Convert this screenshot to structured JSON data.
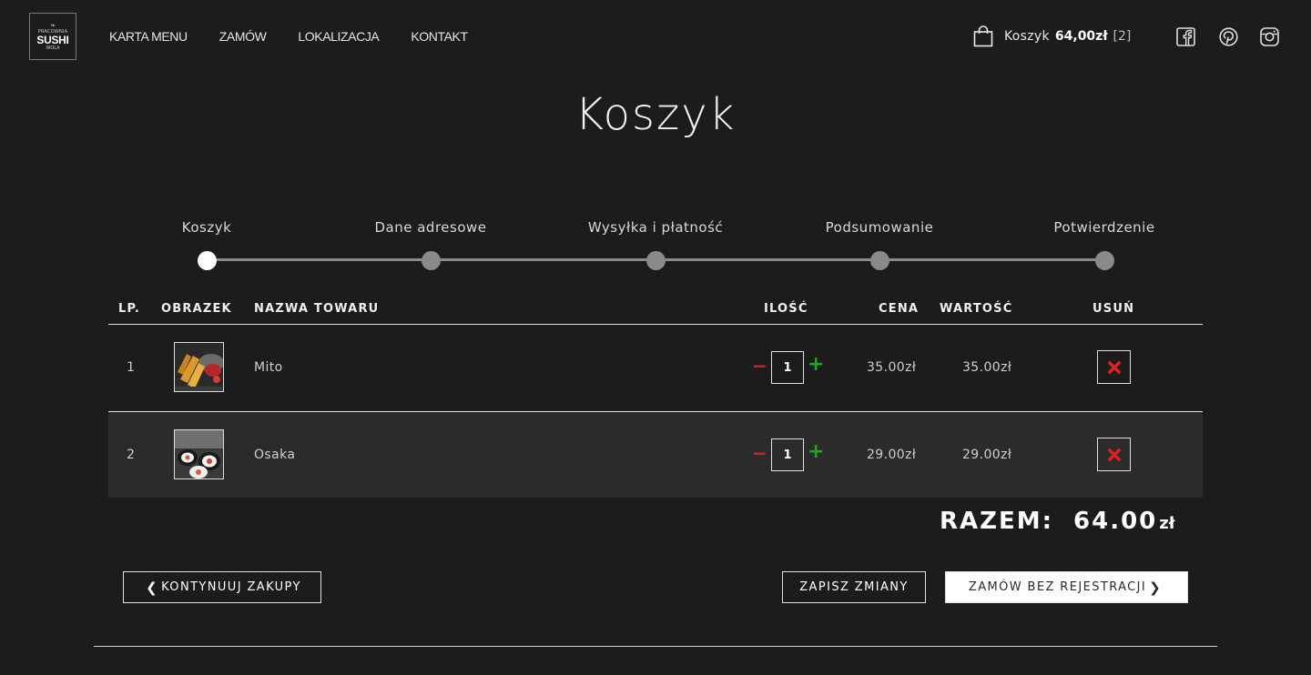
{
  "logo": {
    "line1": "PRACOWNIA",
    "line2": "SUSHI",
    "line3": "WOLA"
  },
  "nav": {
    "items": [
      "KARTA MENU",
      "ZAMÓW",
      "LOKALIZACJA",
      "KONTAKT"
    ]
  },
  "cart": {
    "label": "Koszyk",
    "total": "64,00zł",
    "count": "[2]"
  },
  "social": [
    "facebook-icon",
    "pinterest-icon",
    "instagram-icon"
  ],
  "page": {
    "title": "Koszyk"
  },
  "steps": {
    "items": [
      "Koszyk",
      "Dane adresowe",
      "Wysyłka i płatność",
      "Podsumowanie",
      "Potwierdzenie"
    ],
    "active_index": 0
  },
  "table": {
    "headers": {
      "lp": "LP.",
      "image": "OBRAZEK",
      "name": "NAZWA TOWARU",
      "qty": "ILOŚĆ",
      "price": "CENA",
      "value": "WARTOŚĆ",
      "remove": "USUŃ"
    },
    "rows": [
      {
        "lp": "1",
        "name": "Mito",
        "qty": "1",
        "price": "35.00zł",
        "value": "35.00zł"
      },
      {
        "lp": "2",
        "name": "Osaka",
        "qty": "1",
        "price": "29.00zł",
        "value": "29.00zł"
      }
    ],
    "minus": "−",
    "plus": "+"
  },
  "summary": {
    "label": "RAZEM:",
    "value": "64.00",
    "currency": "zł"
  },
  "buttons": {
    "continue": "KONTYNUUJ ZAKUPY",
    "save": "ZAPISZ ZMIANY",
    "order": "ZAMÓW BEZ REJESTRACJI"
  },
  "colors": {
    "background": "#1c1c1c",
    "minus": "#e02020",
    "plus": "#21a51f",
    "remove": "#e02020"
  }
}
